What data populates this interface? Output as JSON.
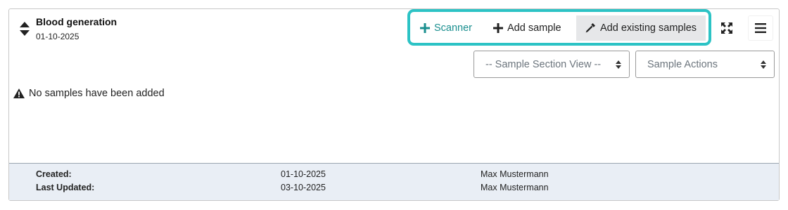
{
  "section": {
    "title": "Blood generation",
    "date": "01-10-2025",
    "icon": "sort-icon"
  },
  "toolbar": {
    "scanner_label": "Scanner",
    "add_sample_label": "Add sample",
    "add_existing_label": "Add existing samples",
    "highlight_color": "#2cc3c5",
    "scanner_color": "#1a8f8f"
  },
  "selects": {
    "view": "-- Sample Section View --",
    "actions": "Sample Actions"
  },
  "empty_message": "No samples have been added",
  "footer": {
    "created_label": "Created:",
    "created_date": "01-10-2025",
    "created_by": "Max Mustermann",
    "updated_label": "Last Updated:",
    "updated_date": "03-10-2025",
    "updated_by": "Max Mustermann"
  }
}
